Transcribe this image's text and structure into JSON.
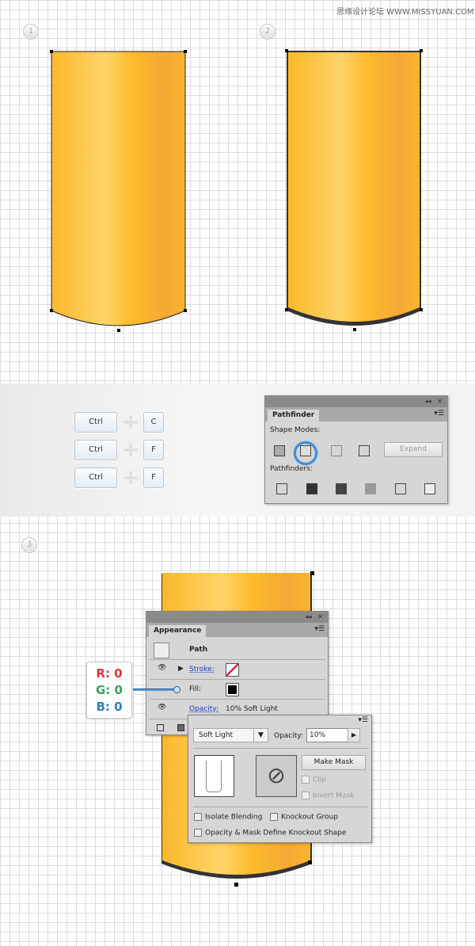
{
  "watermark": "思缘设计论坛 WWW.MISSYUAN.COM",
  "steps": [
    "1",
    "2",
    "3"
  ],
  "shortcuts": [
    {
      "key": "Ctrl",
      "with": "C"
    },
    {
      "key": "Ctrl",
      "with": "F"
    },
    {
      "key": "Ctrl",
      "with": "F"
    }
  ],
  "pathfinder": {
    "title": "Pathfinder",
    "shape_modes_label": "Shape Modes:",
    "pathfinders_label": "Pathfinders:",
    "expand_label": "Expand",
    "shape_modes": [
      "unite-icon",
      "minus-front-icon",
      "intersect-icon",
      "exclude-icon"
    ],
    "selected_mode": "minus-front-icon",
    "pathfinder_ops": [
      "divide-icon",
      "trim-icon",
      "merge-icon",
      "crop-icon",
      "outline-icon",
      "minus-back-icon"
    ]
  },
  "appearance": {
    "title": "Appearance",
    "object": "Path",
    "stroke_label": "Stroke:",
    "fill_label": "Fill:",
    "opacity_label": "Opacity:",
    "opacity_value": "10% Soft Light"
  },
  "rgb": {
    "r": "R: 0",
    "g": "G: 0",
    "b": "B: 0",
    "r_color": "#d9383c",
    "g_color": "#3aa05a",
    "b_color": "#2d7fc1"
  },
  "transparency": {
    "blend_mode": "Soft Light",
    "opacity_label": "Opacity:",
    "opacity_value": "10%",
    "make_mask": "Make Mask",
    "clip": "Clip",
    "invert_mask": "Invert Mask",
    "isolate_blending": "Isolate Blending",
    "knockout_group": "Knockout Group",
    "opacity_mask_knockout": "Opacity & Mask Define Knockout Shape"
  },
  "colors": {
    "gold_light": "#ffd466",
    "gold": "#fdb827",
    "gold_dark": "#f3a534"
  }
}
